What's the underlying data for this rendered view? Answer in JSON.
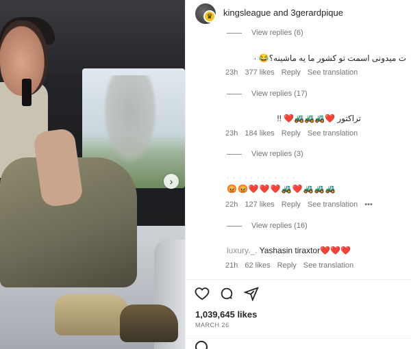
{
  "header": {
    "account1": "kingsleague",
    "conjunction": "and",
    "account2": "3gerardpique"
  },
  "comments": [
    {
      "type": "view_replies",
      "label": "View replies (6)"
    },
    {
      "type": "comment",
      "text": "ت میدونی اسمت تو کشور ما یه ماشینه؟😂 ·",
      "time": "23h",
      "likes": "377 likes",
      "reply": "Reply",
      "translate": "See translation"
    },
    {
      "type": "view_replies",
      "label": "View replies (17)"
    },
    {
      "type": "comment",
      "text": "تراکتور ❤️🚜🚜🚜❤️ !!",
      "time": "23h",
      "likes": "184 likes",
      "reply": "Reply",
      "translate": "See translation"
    },
    {
      "type": "view_replies",
      "label": "View replies (3)"
    },
    {
      "type": "comment",
      "text": "😡😡❤️❤️❤️🚜❤️🚜🚜🚜",
      "time": "22h",
      "likes": "127 likes",
      "reply": "Reply",
      "translate": "See translation",
      "more": "•••"
    },
    {
      "type": "view_replies",
      "label": "View replies (16)"
    },
    {
      "type": "comment",
      "text": "Yashasin tiraxtor❤️❤️❤️",
      "username": "luxury._.",
      "time": "21h",
      "likes": "62 likes",
      "reply": "Reply",
      "translate": "See translation"
    }
  ],
  "actions": {
    "like_icon": "heart-icon",
    "comment_icon": "comment-icon",
    "share_icon": "share-icon"
  },
  "post": {
    "likes": "1,039,645 likes",
    "date": "MARCH 26"
  }
}
